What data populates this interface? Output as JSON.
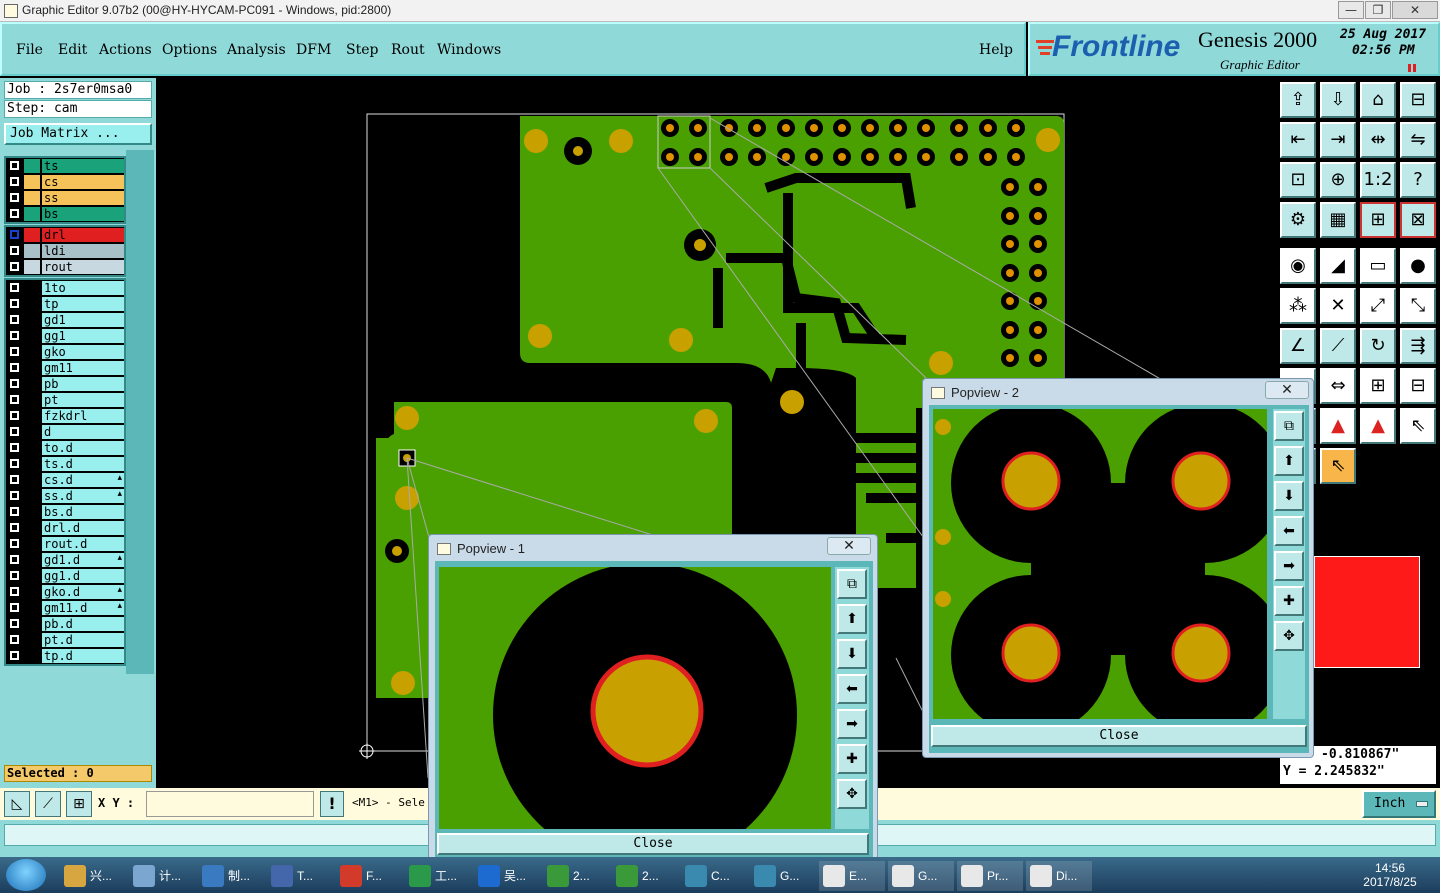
{
  "window": {
    "title": "Graphic Editor 9.07b2 (00@HY-HYCAM-PC091 - Windows, pid:2800)",
    "minimize": "—",
    "maximize": "❐",
    "close": "✕"
  },
  "menu": {
    "file": "File",
    "edit": "Edit",
    "actions": "Actions",
    "options": "Options",
    "analysis": "Analysis",
    "dfm": "DFM",
    "step": "Step",
    "rout": "Rout",
    "windows": "Windows",
    "help": "Help"
  },
  "logo": {
    "brand": "Frontline",
    "product": "Genesis 2000",
    "subtitle": "Graphic Editor",
    "date": "25 Aug 2017",
    "time": "02:56 PM"
  },
  "left": {
    "job": "Job : 2s7er0msa0",
    "step": "Step: cam",
    "job_matrix": "Job Matrix ...",
    "selected": "Selected : 0"
  },
  "layers_board": [
    {
      "name": "ts",
      "color": "#1aa37a"
    },
    {
      "name": "cs",
      "color": "#f6c25a"
    },
    {
      "name": "ss",
      "color": "#f6c25a"
    },
    {
      "name": "bs",
      "color": "#1aa37a"
    }
  ],
  "layers_drill": [
    {
      "name": "drl",
      "color": "#e02020"
    },
    {
      "name": "ldi",
      "color": "#a8c0c8"
    },
    {
      "name": "rout",
      "color": "#c8d8e0"
    }
  ],
  "layers_misc": [
    "1to",
    "tp",
    "gd1",
    "gg1",
    "gko",
    "gm11",
    "pb",
    "pt",
    "fzkdrl",
    "d",
    "to.d",
    "ts.d",
    "cs.d",
    "ss.d",
    "bs.d",
    "drl.d",
    "rout.d",
    "gd1.d",
    "gg1.d",
    "gko.d",
    "gm11.d",
    "pb.d",
    "pt.d",
    "tp.d"
  ],
  "right": {
    "coord_x": "-0.810867\"",
    "coord_y": "Y = 2.245832\""
  },
  "cmd": {
    "xy_label": "X Y :",
    "xy_value": "",
    "mode": "<M1> - Sele",
    "units": "Inch"
  },
  "popview1": {
    "title": "Popview - 1",
    "close": "Close"
  },
  "popview2": {
    "title": "Popview - 2",
    "close": "Close"
  },
  "taskbar": {
    "items": [
      "兴...",
      "计...",
      "制...",
      "T...",
      "F...",
      "工...",
      "吴...",
      "2...",
      "2...",
      "C...",
      "G...",
      "E...",
      "G...",
      "Pr...",
      "Di..."
    ],
    "clock_time": "14:56",
    "clock_date": "2017/8/25"
  },
  "colors": {
    "pcb_green": "#4aa000",
    "pad_gold": "#c8a000",
    "drill_red": "#e02020",
    "panel_teal": "#8fd9d9"
  }
}
